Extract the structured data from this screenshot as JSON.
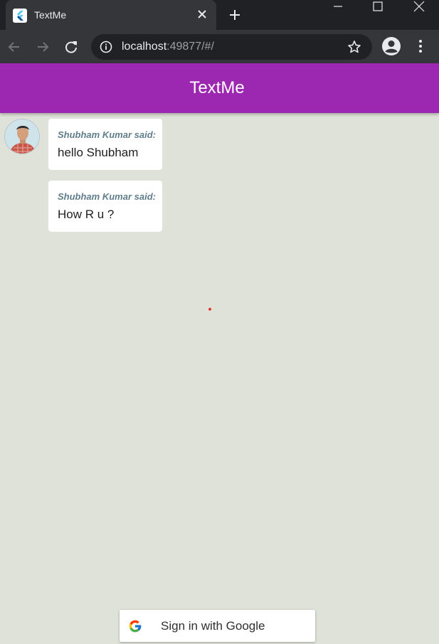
{
  "browser": {
    "tab_title": "TextMe",
    "url_host": "localhost",
    "url_rest": ":49877/#/"
  },
  "app": {
    "title": "TextMe",
    "accent_color": "#9c27b0"
  },
  "messages": [
    {
      "sender": "Shubham Kumar said:",
      "text": "hello Shubham"
    },
    {
      "sender": "Shubham Kumar said:",
      "text": "How R u ?"
    }
  ],
  "signin": {
    "label": "Sign in with Google"
  },
  "icons": {
    "tab": "flutter-logo-icon",
    "close": "close-icon",
    "new_tab": "plus-icon",
    "back": "arrow-back-icon",
    "forward": "arrow-forward-icon",
    "reload": "reload-icon",
    "info": "info-icon",
    "star": "star-icon",
    "profile": "account-circle-icon",
    "menu": "more-vert-icon",
    "google": "google-g-icon"
  }
}
